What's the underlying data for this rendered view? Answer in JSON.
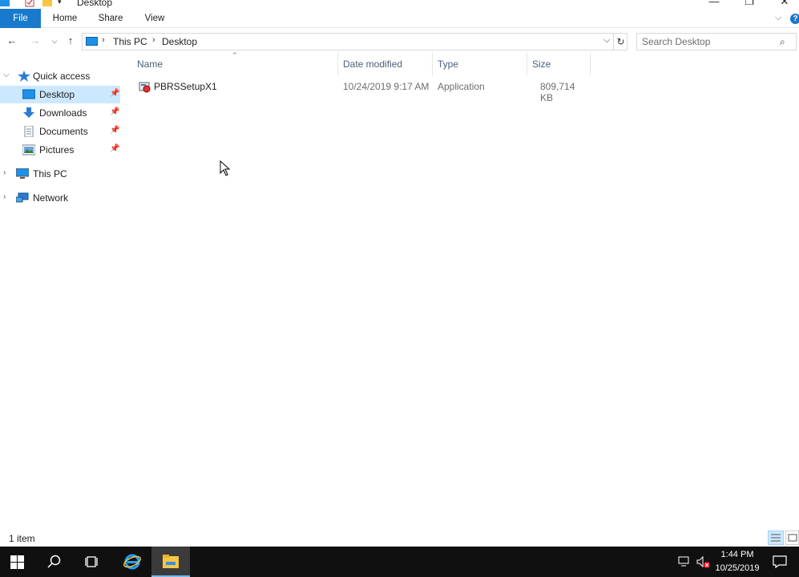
{
  "window": {
    "title": "Desktop"
  },
  "ribbon": {
    "tabs": [
      {
        "label": "File"
      },
      {
        "label": "Home"
      },
      {
        "label": "Share"
      },
      {
        "label": "View"
      }
    ]
  },
  "address": {
    "crumbs": [
      "This PC",
      "Desktop"
    ],
    "search_placeholder": "Search Desktop"
  },
  "nav": {
    "quick_access": "Quick access",
    "items": [
      {
        "label": "Desktop",
        "icon": "desktop-folder-icon",
        "pinned": true,
        "selected": true
      },
      {
        "label": "Downloads",
        "icon": "downloads-folder-icon",
        "pinned": true
      },
      {
        "label": "Documents",
        "icon": "documents-folder-icon",
        "pinned": true
      },
      {
        "label": "Pictures",
        "icon": "pictures-folder-icon",
        "pinned": true
      }
    ],
    "this_pc": "This PC",
    "network": "Network"
  },
  "columns": {
    "name": "Name",
    "date": "Date modified",
    "type": "Type",
    "size": "Size"
  },
  "files": [
    {
      "name": "PBRSSetupX1",
      "date": "10/24/2019 9:17 AM",
      "type": "Application",
      "size": "809,714 KB",
      "icon": "application-installer-icon"
    }
  ],
  "status": {
    "count": "1 item"
  },
  "taskbar": {
    "time": "1:44 PM",
    "date": "10/25/2019"
  },
  "colors": {
    "accent": "#1979ca",
    "selection": "#cce8ff",
    "taskbar": "#101010"
  }
}
